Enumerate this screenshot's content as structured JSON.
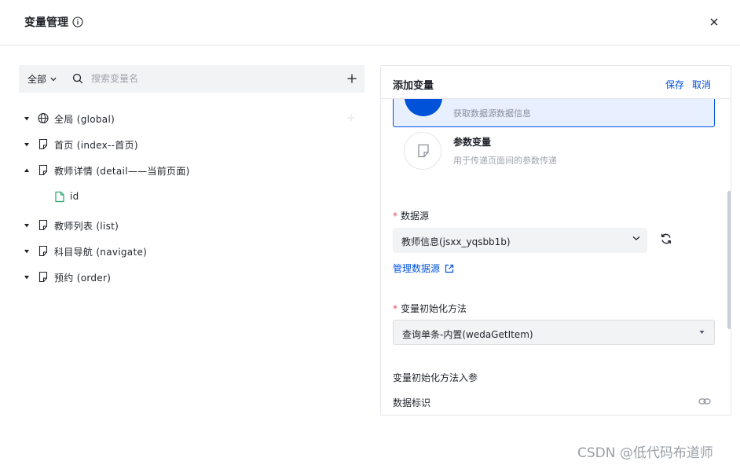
{
  "dialog": {
    "title": "变量管理",
    "close_icon": "close-icon",
    "info_icon": "info-icon"
  },
  "left": {
    "scope_label": "全部",
    "search_placeholder": "搜索变量名",
    "tree": [
      {
        "label": "全局 (global)",
        "icon": "globe-icon",
        "expanded": false
      },
      {
        "label": "首页 (index--首页)",
        "icon": "page-icon",
        "expanded": false
      },
      {
        "label": "教师详情 (detail——当前页面)",
        "icon": "page-icon",
        "expanded": true
      },
      {
        "label": "id",
        "icon": "file-icon",
        "leaf": true
      },
      {
        "label": "教师列表 (list)",
        "icon": "page-icon",
        "expanded": false
      },
      {
        "label": "科目导航 (navigate)",
        "icon": "page-icon",
        "expanded": false
      },
      {
        "label": "预约 (order)",
        "icon": "page-icon",
        "expanded": false
      }
    ]
  },
  "right": {
    "title": "添加变量",
    "save_label": "保存",
    "cancel_label": "取消",
    "selected_card_desc": "获取数据源数据信息",
    "param_card": {
      "title": "参数变量",
      "desc": "用于传递页面间的参数传递"
    },
    "datasource": {
      "label": "数据源",
      "value": "教师信息(jsxx_yqsbb1b)"
    },
    "manage_link": "管理数据源",
    "init_method": {
      "label": "变量初始化方法",
      "value": "查询单条-内置(wedaGetItem)"
    },
    "init_params_label": "变量初始化方法入参",
    "data_id_label": "数据标识"
  },
  "colors": {
    "primary": "#0052d9",
    "required": "#e34d59",
    "toolbar_bg": "#f2f3f5",
    "file_icon": "#2ba471"
  },
  "watermark": "CSDN @低代码布道师"
}
